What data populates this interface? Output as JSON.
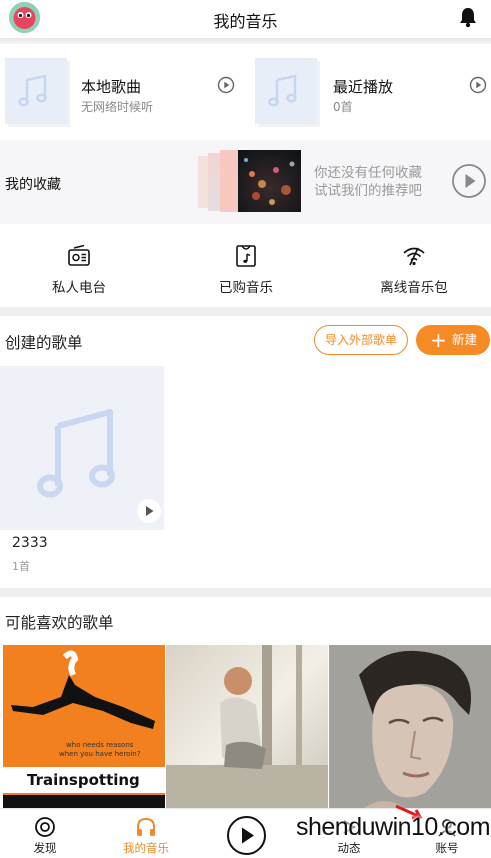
{
  "header": {
    "title": "我的音乐"
  },
  "quick_access": [
    {
      "title": "本地歌曲",
      "subtitle": "无网络时候听"
    },
    {
      "title": "最近播放",
      "subtitle": "0首"
    }
  ],
  "favorites": {
    "label": "我的收藏",
    "empty_line1": "你还没有任何收藏",
    "empty_line2": "试试我们的推荐吧"
  },
  "tools": [
    {
      "label": "私人电台",
      "icon": "radio-icon"
    },
    {
      "label": "已购音乐",
      "icon": "purchased-music-icon"
    },
    {
      "label": "离线音乐包",
      "icon": "offline-wifi-icon"
    }
  ],
  "created_playlists": {
    "title": "创建的歌单",
    "import_label": "导入外部歌单",
    "new_label": "新建",
    "items": [
      {
        "name": "2333",
        "count": "1首"
      }
    ]
  },
  "recommended": {
    "title": "可能喜欢的歌单",
    "cover1_small_text": "who needs reasons\nwhen you have heroin?",
    "cover1_title": "Trainspotting"
  },
  "tabbar": {
    "tabs": [
      {
        "label": "发现",
        "icon": "discover-icon"
      },
      {
        "label": "我的音乐",
        "icon": "headphones-icon",
        "active": true
      },
      {
        "label": "动态",
        "icon": "feed-icon"
      },
      {
        "label": "账号",
        "icon": "account-icon"
      }
    ]
  },
  "watermark": "shenduwin10.com",
  "colors": {
    "accent": "#f28a2a",
    "accent_fill": "#f68b26",
    "placeholder": "#e8eef8",
    "note": "#c7d6ef"
  }
}
